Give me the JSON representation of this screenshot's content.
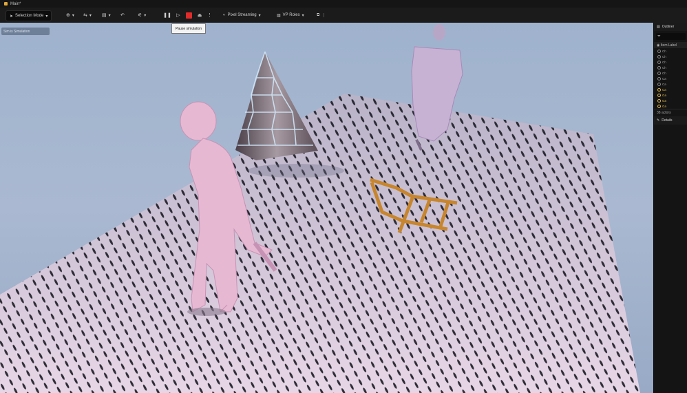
{
  "window": {
    "tab_label": "Main*"
  },
  "toolbar": {
    "mode_label": "Selection Mode",
    "pixel_streaming_label": "Pixel Streaming",
    "vp_roles_label": "VP Roles",
    "tooltip": "Pause simulation"
  },
  "viewport": {
    "overlay_label": "Sim is Simulation"
  },
  "outliner": {
    "title": "Outliner",
    "column_label": "Item Label",
    "rows": [
      {
        "label": "Ch",
        "highlight": false
      },
      {
        "label": "Ch",
        "highlight": false
      },
      {
        "label": "Ch",
        "highlight": false
      },
      {
        "label": "Ch",
        "highlight": false
      },
      {
        "label": "Ch",
        "highlight": false
      },
      {
        "label": "Ca",
        "highlight": false
      },
      {
        "label": "Ca",
        "highlight": false
      },
      {
        "label": "Ca",
        "highlight": true
      },
      {
        "label": "Ga",
        "highlight": true
      },
      {
        "label": "Ga",
        "highlight": true
      },
      {
        "label": "Ga",
        "highlight": true
      }
    ],
    "footer": "38 actors",
    "details_label": "Details"
  },
  "colors": {
    "stop": "#e02b2b",
    "highlight": "#e1b84a",
    "sky": "#a6b6cf"
  }
}
